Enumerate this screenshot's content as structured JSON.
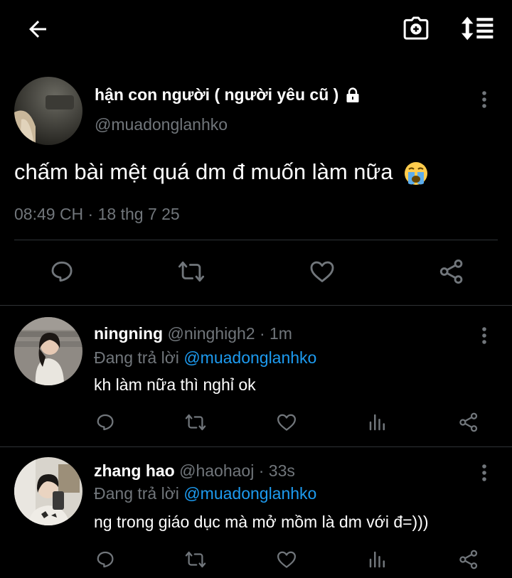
{
  "colors": {
    "background": "#000000",
    "text": "#e7e9ea",
    "muted": "#71767b",
    "accent": "#1d9bf0",
    "divider": "#2f3336"
  },
  "topbar": {
    "back_icon": "arrow-left-icon",
    "camera_icon": "camera-plus-icon",
    "sort_icon": "sort-icon"
  },
  "main_post": {
    "author_name": "hận con người ( người yêu cũ )",
    "lock_icon": "lock-icon",
    "handle": "@muadonglanhko",
    "text": "chấm bài mệt quá dm đ muốn làm nữa",
    "emoji": "loudly-crying-face",
    "timestamp": "08:49 CH · 18 thg 7 25"
  },
  "replies": [
    {
      "name": "ningning",
      "meta": "@ninghigh2 · 1m",
      "replying_to_prefix": "Đang trả lời",
      "replying_to_handle": "@muadonglanhko",
      "text": "kh làm nữa thì nghỉ ok"
    },
    {
      "name": "zhang hao",
      "meta": "@haohaoj · 33s",
      "replying_to_prefix": "Đang trả lời",
      "replying_to_handle": "@muadonglanhko",
      "text": "ng trong giáo dục mà mở mồm là dm với đ=)))"
    }
  ]
}
